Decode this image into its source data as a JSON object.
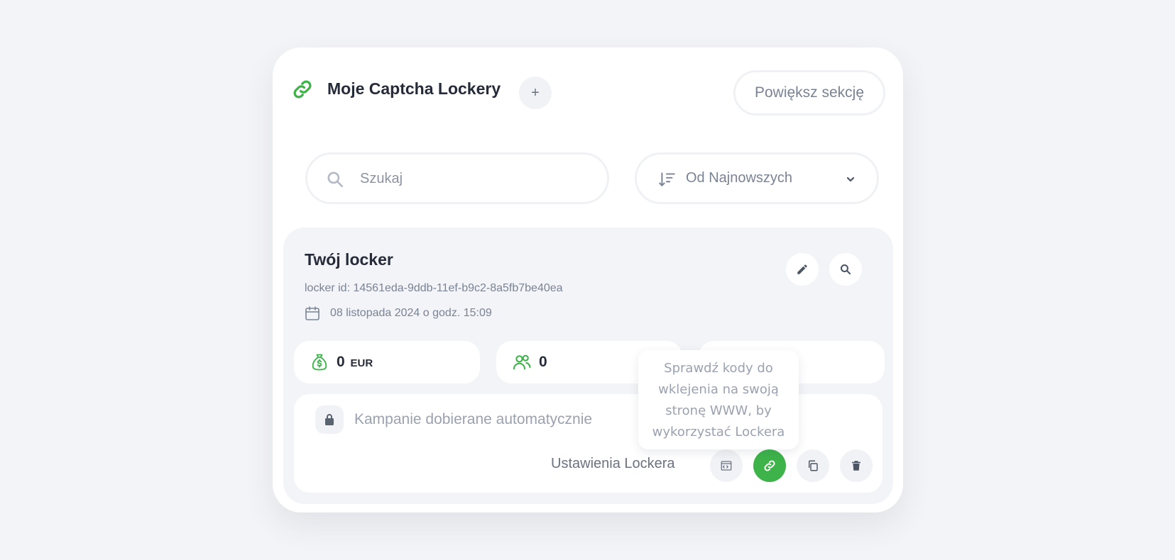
{
  "header": {
    "title": "Moje Captcha Lockery",
    "add_label": "+",
    "enlarge_label": "Powiększ sekcję"
  },
  "search": {
    "placeholder": "Szukaj",
    "value": ""
  },
  "sort": {
    "selected": "Od Najnowszych"
  },
  "locker": {
    "title": "Twój locker",
    "id_text": "locker id: 14561eda-9ddb-11ef-b9c2-8a5fb7be40ea",
    "date_text": "08 listopada 2024 o godz. 15:09",
    "stats": {
      "earnings_value": "0",
      "earnings_currency": "EUR",
      "users_value": "0"
    },
    "campaign_text": "Kampanie dobierane automatycznie",
    "settings_label": "Ustawienia Lockera"
  },
  "tooltip": {
    "lines": [
      "Sprawdź kody do",
      "wklejenia na swoją",
      "stronę WWW, by",
      "wykorzystać Lockera"
    ]
  },
  "colors": {
    "accent": "#3db34a",
    "background": "#f3f4f7",
    "card": "#ffffff",
    "text_dark": "#252b38",
    "text_muted": "#7a8393"
  }
}
